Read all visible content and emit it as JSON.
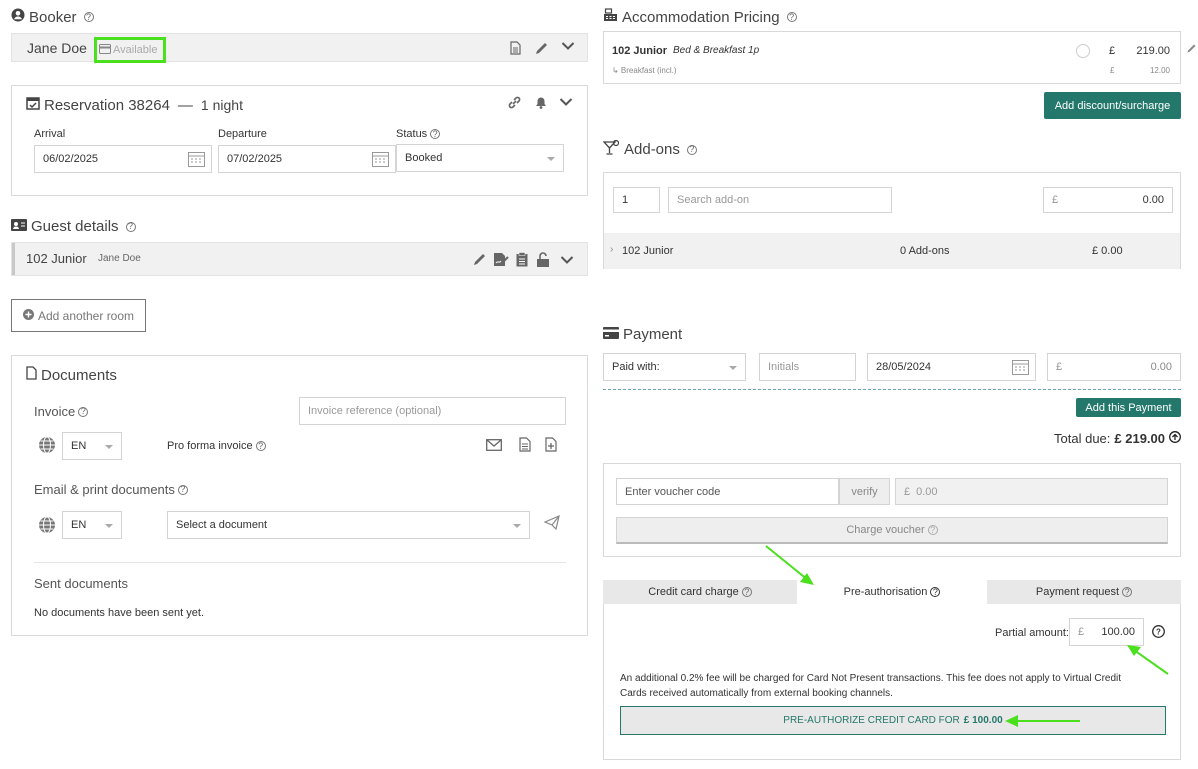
{
  "booker": {
    "title": "Booker",
    "name": "Jane Doe",
    "availability": "Available"
  },
  "reservation": {
    "title": "Reservation 38264",
    "nights": "1 night",
    "arrival_label": "Arrival",
    "arrival_value": "06/02/2025",
    "departure_label": "Departure",
    "departure_value": "07/02/2025",
    "status_label": "Status",
    "status_value": "Booked"
  },
  "guest": {
    "title": "Guest details",
    "room": "102 Junior",
    "guest_name": "Jane Doe"
  },
  "add_room_label": "Add another room",
  "documents": {
    "title": "Documents",
    "invoice_label": "Invoice",
    "invoice_ref_placeholder": "Invoice reference (optional)",
    "lang1": "EN",
    "pro_forma_label": "Pro forma invoice",
    "email_print_label": "Email & print documents",
    "lang2": "EN",
    "select_doc_placeholder": "Select a document",
    "sent_title": "Sent documents",
    "sent_empty": "No documents have been sent yet."
  },
  "pricing": {
    "title": "Accommodation Pricing",
    "room": "102 Junior",
    "plan": "Bed & Breakfast 1p",
    "currency": "£",
    "price": "219.00",
    "sub_item": "↳ Breakfast (incl.)",
    "sub_price": "12.00",
    "discount_button": "Add discount/surcharge"
  },
  "addons": {
    "title": "Add-ons",
    "qty": "1",
    "search_placeholder": "Search add-on",
    "currency": "£",
    "amount": "0.00",
    "row_room": "102 Junior",
    "row_count": "0 Add-ons",
    "row_total": "£ 0.00"
  },
  "payment": {
    "title": "Payment",
    "paid_with": "Paid with:",
    "initials_placeholder": "Initials",
    "date": "28/05/2024",
    "currency": "£",
    "amount": "0.00",
    "add_button": "Add this Payment",
    "total_label": "Total due:",
    "total_value": "£ 219.00"
  },
  "voucher": {
    "code_placeholder": "Enter voucher code",
    "verify": "verify",
    "currency": "£",
    "amount": "0.00",
    "charge": "Charge voucher"
  },
  "tabs": {
    "credit_card": "Credit card charge",
    "preauth": "Pre-authorisation",
    "payment_request": "Payment request"
  },
  "preauth": {
    "partial_label": "Partial amount:",
    "currency": "£",
    "partial_value": "100.00",
    "note": "An additional 0.2% fee will be charged for Card Not Present transactions. This fee does not apply to Virtual Credit Cards received automatically from external booking channels.",
    "button_prefix": "PRE-AUTHORIZE CREDIT CARD FOR",
    "button_amount": "£ 100.00"
  },
  "colors": {
    "accent": "#24786b",
    "highlight": "#4be01e"
  }
}
